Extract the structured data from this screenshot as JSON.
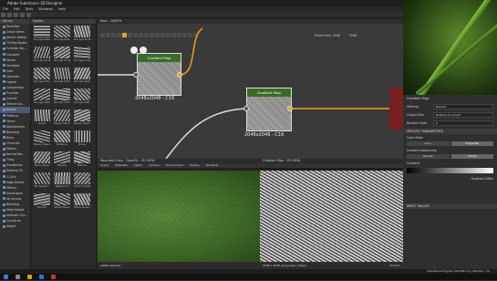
{
  "window": {
    "title": "Adobe Substance 3D Designer"
  },
  "menu": [
    "File",
    "Edit",
    "Tools",
    "Windows",
    "Help"
  ],
  "library": {
    "header": "Library",
    "items": [
      "Favorites",
      "Graph Items",
      "Atomic Nodes",
      "FX-Map Nodes",
      "Function No...",
      "Constant",
      "Vector",
      "Variables",
      "Cast",
      "Operator",
      "Logical",
      "Comparison",
      "Function",
      "Control",
      "Texture Ge...",
      "Noises",
      "Patterns",
      "Filters",
      "Adjustments",
      "Blending",
      "Blurs",
      "Channels",
      "Effects",
      "Normal Ma...",
      "Tiling",
      "Transforms",
      "Material Fil...",
      "1-Click",
      "Edge Detect",
      "Effects",
      "Generators",
      "Structures",
      "Blending",
      "Mesh Based",
      "Ambient Occ...",
      "Curvature",
      "Height"
    ],
    "selected": "Noises"
  },
  "thumbs": {
    "header": "Noises",
    "items": [
      "Grunge Plast...",
      "Grunge Rust fine",
      "Grunge Scratch...",
      "Grunge Scratch...",
      "Grunge Scratch...",
      "Grunge Scratch...",
      "Grunge Shavings",
      "Grunge Spots",
      "Grunge Spots Dirty",
      "Grunge Stains",
      "Grunge Vertical",
      "Grunge Wall...",
      "Liquid",
      "Messy Fibers 1",
      "Messy Fibers 2",
      "Messy Fibers 3",
      "Moisture",
      "Noise",
      "Perlin Noise",
      "Plasma",
      "Plasma",
      "3D Caustic...",
      "Reference",
      "Voronoi Fractal",
      "Voronoi",
      "White Noise",
      "White Noise Fast"
    ]
  },
  "graph": {
    "tab": "New - GRAPH",
    "node1": {
      "title": "Gradient Map",
      "caption": "2048x2048 - C16"
    },
    "node2": {
      "title": "Gradient Map",
      "caption": "2048x2048 - C16"
    },
    "toolbar_right": {
      "parent_size": "Parent Size: 2048",
      "size": "2048"
    }
  },
  "view3d": {
    "tab": "Rounded Cube - OpenGL - 3D VIEW",
    "menu": [
      "Scene",
      "Materials",
      "Lights",
      "Camera",
      "Environment",
      "Display",
      "Renderer"
    ],
    "footer": "sRGB (default)"
  },
  "view2d": {
    "tab": "Gradient Map - 2D VIEW",
    "footer": "2048 x 2048 (Grayscale, 16bpc)",
    "zoom": "50.00%"
  },
  "properties": {
    "title": "Gradient Map",
    "base_params": [
      {
        "label": "Filtering",
        "value": "Bilinear"
      },
      {
        "label": "Output Size",
        "value": "Relative to parent"
      },
      {
        "label": "Random Seed",
        "value": "0"
      }
    ],
    "specific_header": "SPECIFIC PARAMETERS",
    "color_mode": {
      "label": "Color Mode",
      "options": [
        "Color",
        "Grayscale"
      ],
      "selected": "Grayscale"
    },
    "gradient_addressing": {
      "label": "Gradient Addressing",
      "options": [
        "Repeat",
        "Clamp"
      ],
      "selected": "Clamp"
    },
    "gradient_label": "Gradient",
    "gradient_editor": "Gradient Editor",
    "input_header": "INPUT VALUES"
  },
  "status": {
    "engine": "Substance Engine: Direct3D 11 | Memory: 1%"
  },
  "colors": {
    "accent": "#f0a020",
    "node_header": "#3b6b25",
    "selection": "#4a5a78"
  }
}
